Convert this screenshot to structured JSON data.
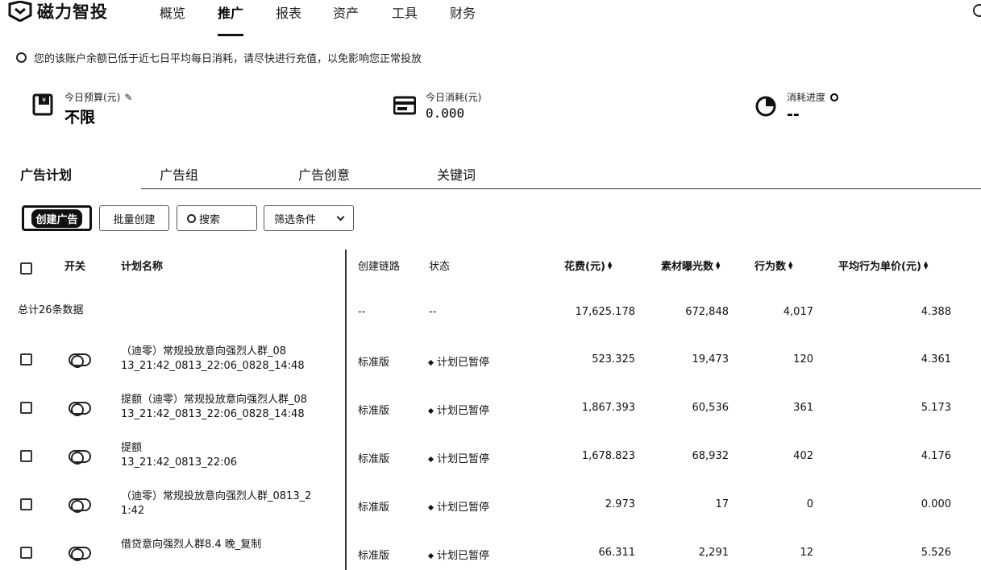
{
  "brand": {
    "name": "磁力智投"
  },
  "nav": {
    "items": [
      {
        "label": "概览",
        "active": false
      },
      {
        "label": "推广",
        "active": true
      },
      {
        "label": "报表",
        "active": false
      },
      {
        "label": "资产",
        "active": false
      },
      {
        "label": "工具",
        "active": false
      },
      {
        "label": "财务",
        "active": false
      }
    ]
  },
  "notice": {
    "text": "您的该账户余额已低于近七日平均每日消耗，请尽快进行充值，以免影响您正常投放"
  },
  "stats": {
    "budget": {
      "label": "今日预算(元)",
      "value": "不限"
    },
    "spend": {
      "label": "今日消耗(元)",
      "value": "0.000"
    },
    "progress": {
      "label": "消耗进度",
      "value": "--"
    }
  },
  "tabs": [
    {
      "label": "广告计划",
      "active": true
    },
    {
      "label": "广告组",
      "active": false
    },
    {
      "label": "广告创意",
      "active": false
    },
    {
      "label": "关键词",
      "active": false
    }
  ],
  "toolbar": {
    "create_label": "创建广告",
    "batch_label": "批量创建",
    "search_placeholder": "搜索",
    "filter_label": "筛选条件"
  },
  "table": {
    "headers": {
      "switch": "开关",
      "name": "计划名称",
      "chain": "创建链路",
      "status": "状态",
      "cost": "花费(元)",
      "impressions": "素材曝光数",
      "actions": "行为数",
      "avg_price": "平均行为单价(元)"
    },
    "total": {
      "label": "总计26条数据",
      "chain": "--",
      "status": "--",
      "cost": "17,625.178",
      "impressions": "672,848",
      "actions": "4,017",
      "avg_price": "4.388"
    },
    "rows": [
      {
        "name_1": "（迪零）常规投放意向强烈人群_08",
        "name_2": "13_21:42_0813_22:06_0828_14:48",
        "chain": "标准版",
        "status": "计划已暂停",
        "cost": "523.325",
        "impressions": "19,473",
        "actions": "120",
        "avg_price": "4.361"
      },
      {
        "name_1": "提额（迪零）常规投放意向强烈人群_08",
        "name_2": "13_21:42_0813_22:06_0828_14:48",
        "chain": "标准版",
        "status": "计划已暂停",
        "cost": "1,867.393",
        "impressions": "60,536",
        "actions": "361",
        "avg_price": "5.173"
      },
      {
        "name_1": "提额",
        "name_2": "13_21:42_0813_22:06",
        "chain": "标准版",
        "status": "计划已暂停",
        "cost": "1,678.823",
        "impressions": "68,932",
        "actions": "402",
        "avg_price": "4.176"
      },
      {
        "name_1": "（迪零）常规投放意向强烈人群_0813_2",
        "name_2": "1:42",
        "chain": "标准版",
        "status": "计划已暂停",
        "cost": "2.973",
        "impressions": "17",
        "actions": "0",
        "avg_price": "0.000"
      },
      {
        "name_1": "借贷意向强烈人群8.4 晚_复制",
        "name_2": "",
        "chain": "标准版",
        "status": "计划已暂停",
        "cost": "66.311",
        "impressions": "2,291",
        "actions": "12",
        "avg_price": "5.526"
      }
    ]
  }
}
